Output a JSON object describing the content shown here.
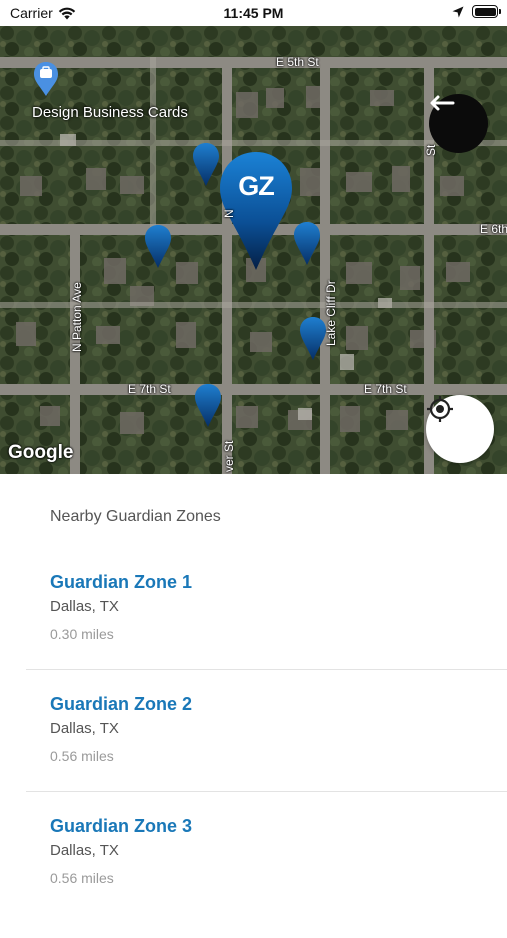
{
  "status_bar": {
    "carrier": "Carrier",
    "time": "11:45 PM"
  },
  "map": {
    "roads": {
      "e5th": "E 5th St",
      "e6th": "E 6th",
      "e7th_left": "E 7th St",
      "e7th_right": "E 7th St",
      "n_patton": "N Patton Ave",
      "lake_cliff": "Lake Cliff Dr",
      "n_cross": "N",
      "ver_st": "ver St",
      "st_right": "St"
    },
    "poi_label": "Design Business Cards",
    "main_pin_text": "GZ",
    "google_logo": "Google",
    "pin_color": "#0a5fa8"
  },
  "list": {
    "title": "Nearby Guardian Zones",
    "zones": [
      {
        "name": "Guardian Zone 1",
        "location": "Dallas, TX",
        "distance": "0.30 miles"
      },
      {
        "name": "Guardian Zone 2",
        "location": "Dallas, TX",
        "distance": "0.56 miles"
      },
      {
        "name": "Guardian Zone 3",
        "location": "Dallas, TX",
        "distance": "0.56 miles"
      }
    ]
  }
}
